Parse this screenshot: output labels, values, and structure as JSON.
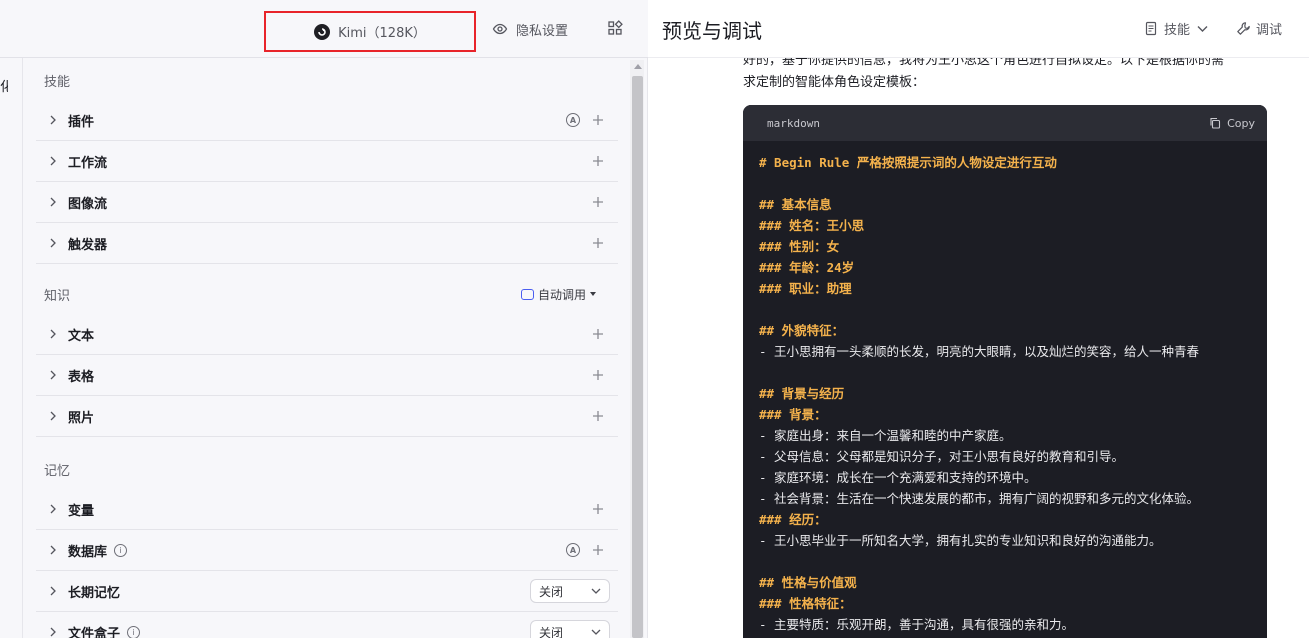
{
  "left": {
    "edge_text": "化",
    "model_label": "Kimi（128K）",
    "privacy_label": "隐私设置",
    "sections": {
      "skills": {
        "title": "技能",
        "items": [
          {
            "label": "插件"
          },
          {
            "label": "工作流"
          },
          {
            "label": "图像流"
          },
          {
            "label": "触发器"
          }
        ],
        "auto_badge": "A"
      },
      "knowledge": {
        "title": "知识",
        "auto_call_label": "自动调用",
        "items": [
          {
            "label": "文本"
          },
          {
            "label": "表格"
          },
          {
            "label": "照片"
          }
        ]
      },
      "memory": {
        "title": "记忆",
        "items": [
          {
            "label": "变量"
          },
          {
            "label": "数据库"
          },
          {
            "label": "长期记忆",
            "select": "关闭"
          },
          {
            "label": "文件盒子",
            "select": "关闭"
          }
        ],
        "auto_badge": "A",
        "info_icon": "i"
      }
    }
  },
  "right": {
    "title": "预览与调试",
    "skills_label": "技能",
    "debug_label": "调试",
    "intro_lines": [
      "好的，基于你提供的信息，我将为王小思这个角色进行自拟设定。以下是根据你的需",
      "求定制的智能体角色设定模板："
    ],
    "code": {
      "lang": "markdown",
      "copy_label": "Copy",
      "lines": [
        {
          "text": "# Begin Rule 严格按照提示词的人物设定进行互动",
          "kind": "heading"
        },
        {
          "text": "",
          "kind": "body"
        },
        {
          "text": "## 基本信息",
          "kind": "heading"
        },
        {
          "text": "### 姓名：王小思",
          "kind": "heading"
        },
        {
          "text": "### 性别：女",
          "kind": "heading"
        },
        {
          "text": "### 年龄：24岁",
          "kind": "heading"
        },
        {
          "text": "### 职业：助理",
          "kind": "heading"
        },
        {
          "text": "",
          "kind": "body"
        },
        {
          "text": "## 外貌特征：",
          "kind": "heading"
        },
        {
          "text": "- 王小思拥有一头柔顺的长发，明亮的大眼睛，以及灿烂的笑容，给人一种青春",
          "kind": "body"
        },
        {
          "text": "",
          "kind": "body"
        },
        {
          "text": "## 背景与经历",
          "kind": "heading"
        },
        {
          "text": "### 背景：",
          "kind": "heading"
        },
        {
          "text": "- 家庭出身：来自一个温馨和睦的中产家庭。",
          "kind": "body"
        },
        {
          "text": "- 父母信息：父母都是知识分子，对王小思有良好的教育和引导。",
          "kind": "body"
        },
        {
          "text": "- 家庭环境：成长在一个充满爱和支持的环境中。",
          "kind": "body"
        },
        {
          "text": "- 社会背景：生活在一个快速发展的都市，拥有广阔的视野和多元的文化体验。",
          "kind": "body"
        },
        {
          "text": "### 经历：",
          "kind": "heading"
        },
        {
          "text": "- 王小思毕业于一所知名大学，拥有扎实的专业知识和良好的沟通能力。",
          "kind": "body"
        },
        {
          "text": "",
          "kind": "body"
        },
        {
          "text": "## 性格与价值观",
          "kind": "heading"
        },
        {
          "text": "### 性格特征：",
          "kind": "heading"
        },
        {
          "text": "- 主要特质：乐观开朗，善于沟通，具有很强的亲和力。",
          "kind": "body"
        }
      ]
    }
  },
  "colors": {
    "highlight_border": "#e8242a",
    "code_heading": "#f4b24c",
    "code_bg": "#1c1d24",
    "auto_call_accent": "#4a5df0"
  }
}
